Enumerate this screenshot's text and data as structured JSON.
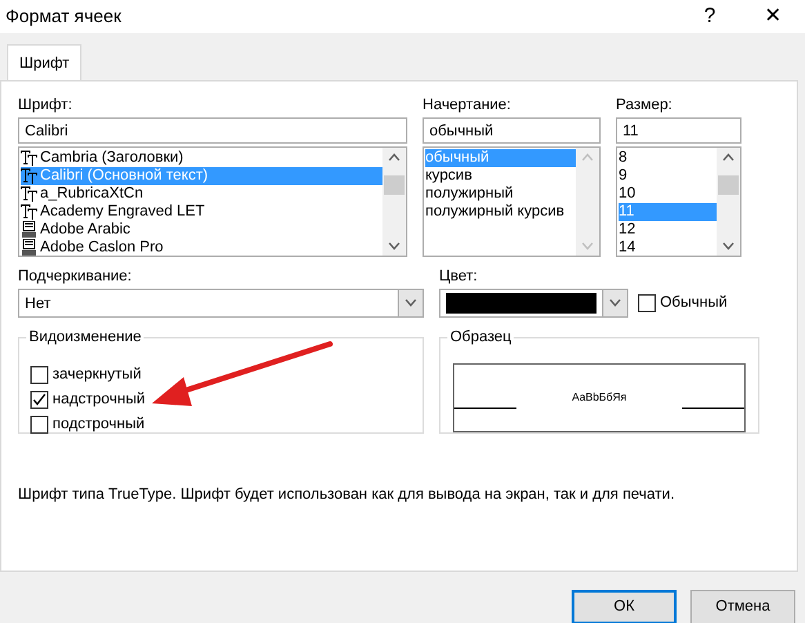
{
  "window": {
    "title": "Формат ячеек",
    "help": "?",
    "close": "✕"
  },
  "tabs": [
    {
      "label": "Шрифт",
      "selected": true
    }
  ],
  "font": {
    "label": "Шрифт:",
    "value": "Calibri",
    "items": [
      {
        "label": "Cambria (Заголовки)",
        "kind": "truetype",
        "selected": false
      },
      {
        "label": "Calibri (Основной текст)",
        "kind": "truetype",
        "selected": true
      },
      {
        "label": "a_RubricaXtCn",
        "kind": "truetype",
        "selected": false
      },
      {
        "label": "Academy Engraved LET",
        "kind": "truetype",
        "selected": false
      },
      {
        "label": "Adobe Arabic",
        "kind": "printer",
        "selected": false
      },
      {
        "label": "Adobe Caslon Pro",
        "kind": "printer",
        "selected": false
      }
    ]
  },
  "style": {
    "label": "Начертание:",
    "value": "обычный",
    "items": [
      {
        "label": "обычный",
        "selected": true
      },
      {
        "label": "курсив",
        "selected": false
      },
      {
        "label": "полужирный",
        "selected": false
      },
      {
        "label": "полужирный курсив",
        "selected": false
      }
    ]
  },
  "size": {
    "label": "Размер:",
    "value": "11",
    "items": [
      {
        "label": "8",
        "selected": false
      },
      {
        "label": "9",
        "selected": false
      },
      {
        "label": "10",
        "selected": false
      },
      {
        "label": "11",
        "selected": true
      },
      {
        "label": "12",
        "selected": false
      },
      {
        "label": "14",
        "selected": false
      }
    ]
  },
  "underline": {
    "label": "Подчеркивание:",
    "value": "Нет"
  },
  "color": {
    "label": "Цвет:",
    "color": "#000000",
    "normal": {
      "label": "Обычный",
      "checked": false
    }
  },
  "effects": {
    "title": "Видоизменение",
    "items": [
      {
        "label": "зачеркнутый",
        "checked": false
      },
      {
        "label": "надстрочный",
        "checked": true
      },
      {
        "label": "подстрочный",
        "checked": false
      }
    ]
  },
  "preview": {
    "title": "Образец",
    "sample": "AaBbБбЯя"
  },
  "description": "Шрифт типа TrueType. Шрифт будет использован как для вывода на экран, так и для печати.",
  "buttons": [
    {
      "label": "ОК",
      "kind": "default"
    },
    {
      "label": "Отмена",
      "kind": "normal"
    }
  ]
}
